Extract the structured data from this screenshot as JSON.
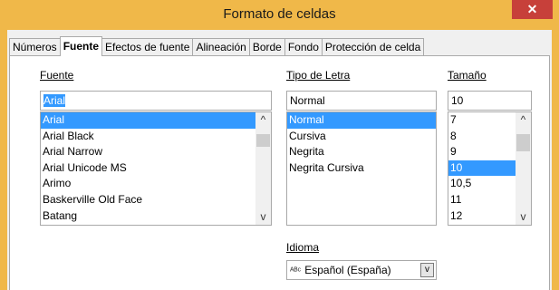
{
  "window": {
    "title": "Formato de celdas",
    "close_glyph": "✕"
  },
  "tabs": [
    {
      "label": "Números"
    },
    {
      "label": "Fuente"
    },
    {
      "label": "Efectos de fuente"
    },
    {
      "label": "Alineación"
    },
    {
      "label": "Borde"
    },
    {
      "label": "Fondo"
    },
    {
      "label": "Protección de celda"
    }
  ],
  "font": {
    "label": "Fuente",
    "value": "Arial",
    "items": [
      "Arial",
      "Arial Black",
      "Arial Narrow",
      "Arial Unicode MS",
      "Arimo",
      "Baskerville Old Face",
      "Batang"
    ],
    "selected_index": 0
  },
  "style": {
    "label": "Tipo de Letra",
    "value": "Normal",
    "items": [
      "Normal",
      "Cursiva",
      "Negrita",
      "Negrita Cursiva"
    ],
    "selected_index": 0
  },
  "size": {
    "label": "Tamaño",
    "value": "10",
    "items": [
      "7",
      "8",
      "9",
      "10",
      "10,5",
      "11",
      "12"
    ],
    "selected_index": 3
  },
  "language": {
    "label": "Idioma",
    "value": "Español (España)",
    "icon": "spellcheck-icon"
  },
  "icons": {
    "scroll_up": "^",
    "scroll_down": "v",
    "dropdown": "v",
    "abc": "ᴬᴮᶜ"
  },
  "colors": {
    "titlebar": "#f0b849",
    "close": "#c7403a",
    "selection": "#3399ff"
  }
}
